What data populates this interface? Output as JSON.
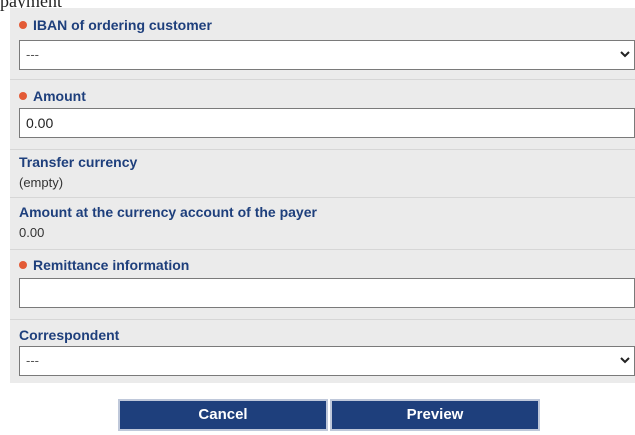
{
  "header_clip": "payment",
  "fields": {
    "iban": {
      "label": "IBAN of ordering customer",
      "value": "---"
    },
    "amount": {
      "label": "Amount",
      "value": "0.00"
    },
    "transfer_currency": {
      "label": "Transfer currency",
      "value": "(empty)"
    },
    "amount_payer": {
      "label": "Amount at the currency account of the payer",
      "value": "0.00"
    },
    "remittance": {
      "label": "Remittance information",
      "value": ""
    },
    "correspondent": {
      "label": "Correspondent",
      "value": "---"
    }
  },
  "buttons": {
    "cancel": "Cancel",
    "preview": "Preview"
  },
  "colors": {
    "label": "#1e3f7c",
    "required_marker": "#e35a36",
    "button_bg": "#1e3f7c",
    "form_bg": "#ebebeb"
  },
  "icons": {
    "required": "required-dot-icon",
    "dropdown": "chevron-down-icon"
  }
}
